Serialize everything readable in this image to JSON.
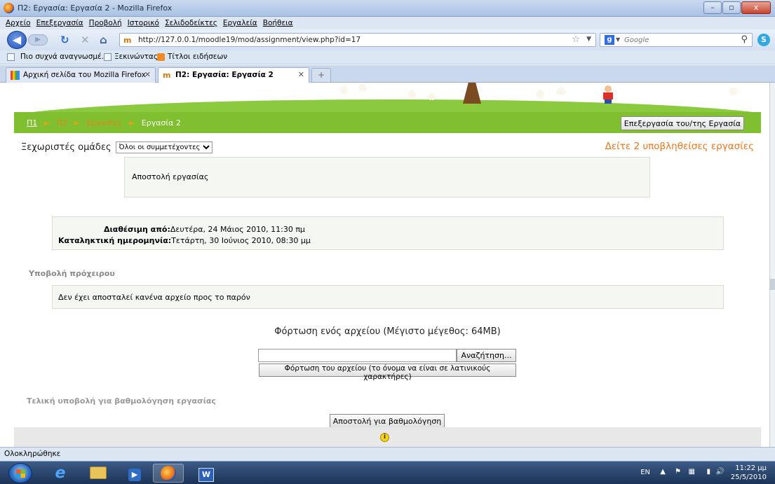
{
  "window": {
    "title": "Π2: Εργασία: Εργασία 2 - Mozilla Firefox",
    "buttons": {
      "minimize": "–",
      "maximize": "▫",
      "close": "x"
    }
  },
  "menu": [
    "Αρχείο",
    "Επεξεργασία",
    "Προβολή",
    "Ιστορικό",
    "Σελιδοδείκτες",
    "Εργαλεία",
    "Βοήθεια"
  ],
  "nav": {
    "url": "http://127.0.0.1/moodle19/mod/assignment/view.php?id=17",
    "favicon": "m",
    "search_placeholder": "Google"
  },
  "bookmarks": [
    {
      "label": "Πιο συχνά αναγνωσμέ...",
      "icon": "most-visited-icon"
    },
    {
      "label": "Ξεκινώντας",
      "icon": "page-icon"
    },
    {
      "label": "Τίτλοι ειδήσεων",
      "icon": "rss-icon"
    }
  ],
  "tabs": [
    {
      "label": "Αρχική σελίδα του Mozilla Firefox",
      "active": false
    },
    {
      "label": "Π2: Εργασία: Εργασία 2",
      "active": true
    }
  ],
  "page": {
    "breadcrumbs": [
      {
        "label": "Π1",
        "kind": "link"
      },
      {
        "label": "Π2",
        "kind": "current-course"
      },
      {
        "label": "Εργασίες",
        "kind": "section"
      },
      {
        "label": "Εργασία 2",
        "kind": "current"
      }
    ],
    "breadcrumb_separator": "►",
    "edit_button": "Επεξεργασία του/της Εργασία",
    "groups_label": "Ξεχωριστές ομάδες",
    "groups_selected": "Όλοι οι συμμετέχοντες",
    "submitted_link": "Δείτε 2 υποβληθείσες εργασίες",
    "intro": "Αποστολή εργασίας",
    "available_from_label": "Διαθέσιμη από:",
    "available_from_value": "Δευτέρα, 24 Μάιος 2010, 11:30 πμ",
    "due_label": "Καταληκτική ημερομηνία:",
    "due_value": "Τετάρτη, 30 Ιούνιος 2010, 08:30 μμ",
    "draft_heading": "Υποβολή πρόχειρου",
    "draft_empty": "Δεν έχει αποσταλεί κανένα αρχείο προς το παρόν",
    "upload_heading": "Φόρτωση ενός αρχείου (Μέγιστο μέγεθος: 64MB)",
    "browse_button": "Αναζήτηση...",
    "upload_button": "Φόρτωση του αρχείου (το όνομα να είναι σε λατινικούς χαρακτήρες)",
    "final_heading": "Τελική υποβολή για βαθμολόγηση εργασίας",
    "send_button": "Αποστολή για βαθμολόγηση"
  },
  "status": "Ολοκληρώθηκε",
  "taskbar": {
    "apps": [
      "internet-explorer",
      "file-explorer",
      "media-player",
      "firefox",
      "word"
    ],
    "language": "EN",
    "time": "11:22 μμ",
    "date": "25/5/2010"
  },
  "colors": {
    "breadcrumb_bar": "#80bf2f",
    "link_orange": "#e8751c",
    "panel_bg": "#f5f7f2"
  }
}
